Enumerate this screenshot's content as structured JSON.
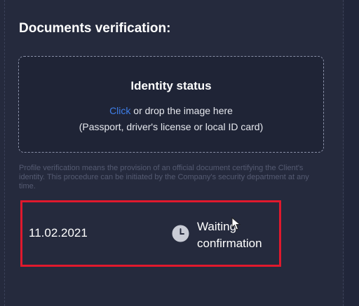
{
  "section": {
    "title": "Documents verification:"
  },
  "dropzone": {
    "title": "Identity status",
    "link_text": "Click",
    "line1_rest": " or drop the image here",
    "line2": "(Passport, driver's license or local ID card)"
  },
  "note": "Profile verification means the provision of an official document certifying the Client's identity. This procedure can be initiated by the Company's security department at any time.",
  "status_entry": {
    "date": "11.02.2021",
    "status_line1": "Waiting",
    "status_line2": "confirmation",
    "icon": "clock-icon"
  },
  "colors": {
    "background": "#252a3d",
    "link": "#3f7ee8",
    "highlight": "#e0192d"
  }
}
